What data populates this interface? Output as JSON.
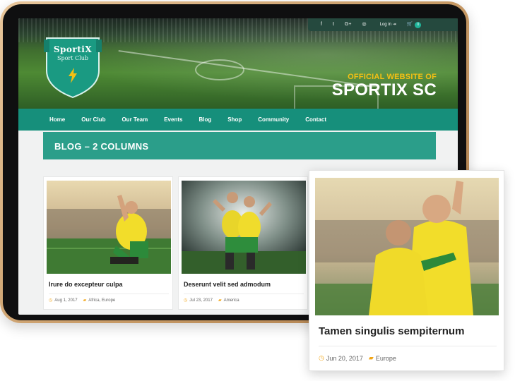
{
  "site": {
    "club_name": "SportiX",
    "club_subtitle": "Sport Club",
    "tagline": "OFFICIAL WEBSITE OF",
    "site_name": "SPORTIX SC"
  },
  "topbar": {
    "facebook": "f",
    "twitter": "t",
    "google_plus": "G+",
    "instagram": "◎",
    "login_label": "Log in",
    "cart_icon": "cart-icon",
    "cart_count": "0"
  },
  "nav": {
    "items": [
      "Home",
      "Our Club",
      "Our Team",
      "Events",
      "Blog",
      "Shop",
      "Community",
      "Contact"
    ]
  },
  "banner": {
    "title": "BLOG – 2 COLUMNS"
  },
  "posts": [
    {
      "title": "Irure do excepteur culpa",
      "date": "Aug 1, 2017",
      "categories": "Africa, Europe"
    },
    {
      "title": "Deserunt velit sed admodum",
      "date": "Jul 23, 2017",
      "categories": "America"
    },
    {
      "title": "Tamen singulis sempiternum",
      "date": "Jun 20, 2017",
      "categories": "Europe"
    }
  ],
  "colors": {
    "primary": "#168f7b",
    "banner": "#2b9e8a",
    "accent": "#f5c013",
    "meta_icon": "#f2a516"
  }
}
